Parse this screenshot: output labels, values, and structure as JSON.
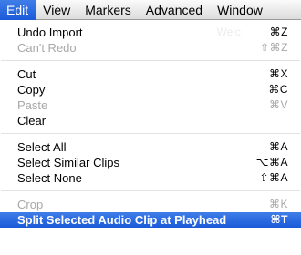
{
  "menubar": {
    "items": [
      "Edit",
      "View",
      "Markers",
      "Advanced",
      "Window"
    ]
  },
  "background_hint": "Welc",
  "menu": {
    "group1": [
      {
        "label": "Undo Import",
        "shortcut": "⌘Z",
        "enabled": true
      },
      {
        "label": "Can't Redo",
        "shortcut": "⇧⌘Z",
        "enabled": false
      }
    ],
    "group2": [
      {
        "label": "Cut",
        "shortcut": "⌘X",
        "enabled": true
      },
      {
        "label": "Copy",
        "shortcut": "⌘C",
        "enabled": true
      },
      {
        "label": "Paste",
        "shortcut": "⌘V",
        "enabled": false
      },
      {
        "label": "Clear",
        "shortcut": "",
        "enabled": true
      }
    ],
    "group3": [
      {
        "label": "Select All",
        "shortcut": "⌘A",
        "enabled": true
      },
      {
        "label": "Select Similar Clips",
        "shortcut": "⌥⌘A",
        "enabled": true
      },
      {
        "label": "Select None",
        "shortcut": "⇧⌘A",
        "enabled": true
      }
    ],
    "group4": [
      {
        "label": "Crop",
        "shortcut": "⌘K",
        "enabled": false
      },
      {
        "label": "Split Selected Audio Clip at Playhead",
        "shortcut": "⌘T",
        "enabled": true,
        "highlighted": true
      }
    ]
  },
  "colors": {
    "highlight": "#2a6ae0",
    "disabled_text": "#a8a8a8"
  }
}
